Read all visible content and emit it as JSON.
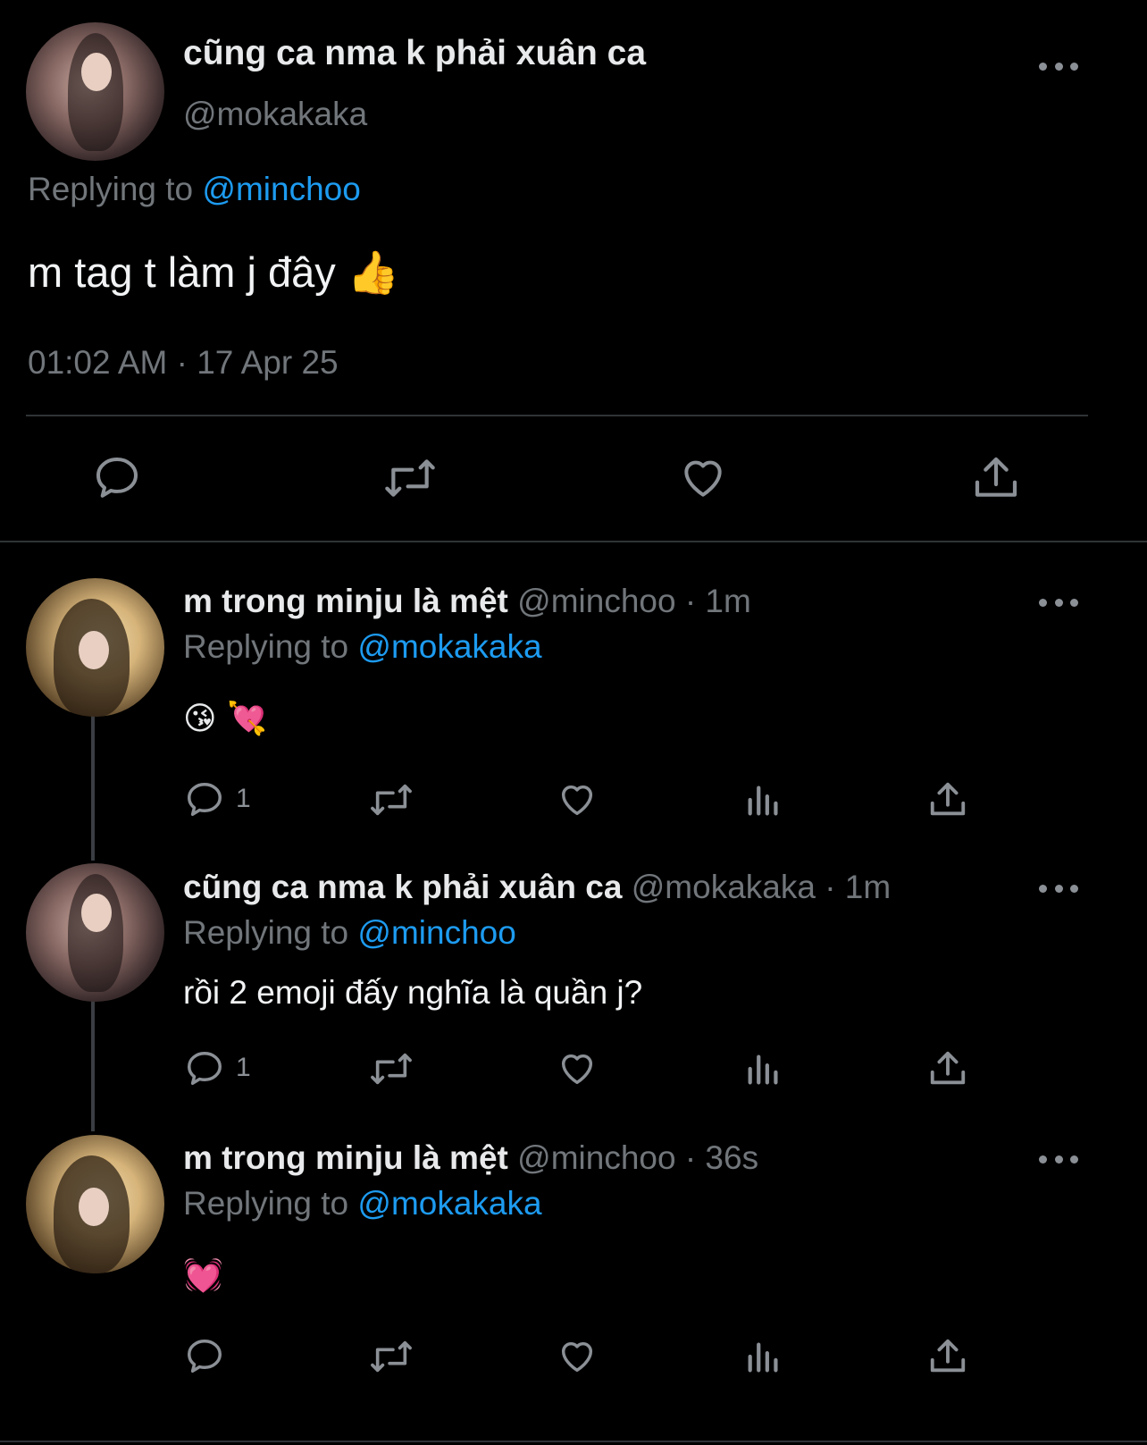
{
  "main_tweet": {
    "name": "cũng ca nma k phải xuân ca",
    "handle": "@mokakaka",
    "replying_prefix": "Replying to",
    "replying_to": "@minchoo",
    "text": "m tag t làm j đây",
    "emoji": "👍",
    "timestamp": "01:02 AM · 17 Apr 25",
    "actions": [
      "reply-icon",
      "retweet-icon",
      "like-icon",
      "share-icon"
    ]
  },
  "replies": [
    {
      "name": "m trong minju là mệt",
      "handle_time": "@minchoo · 1m",
      "replying_prefix": "Replying to",
      "replying_to": "@mokakaka",
      "emoji": "😘 💘",
      "reply_count": "1"
    },
    {
      "name": "cũng ca nma k phải xuân ca",
      "handle_time": "@mokakaka · 1m",
      "replying_prefix": "Replying to",
      "replying_to": "@minchoo",
      "text": "rồi 2 emoji đấy nghĩa là quần j?",
      "reply_count": "1"
    },
    {
      "name": "m trong minju là mệt",
      "handle_time": "@minchoo · 36s",
      "replying_prefix": "Replying to",
      "replying_to": "@mokakaka",
      "emoji": "💓",
      "reply_count": ""
    }
  ],
  "colors": {
    "background": "#000000",
    "text": "#e7e9ea",
    "muted": "#71767b",
    "link": "#1d9bf0",
    "divider": "#2f3336"
  }
}
